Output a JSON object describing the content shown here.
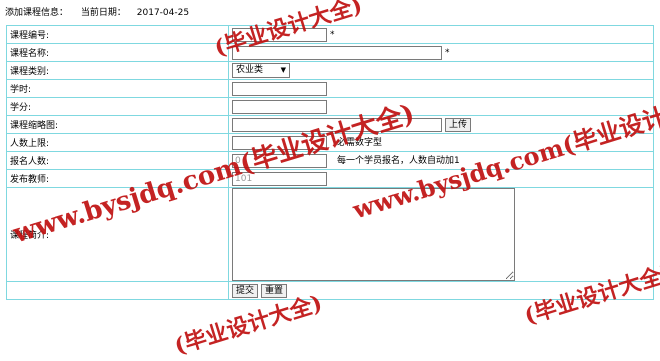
{
  "header": {
    "title": "添加课程信息：",
    "date_label": "当前日期：",
    "date_value": "2017-04-25"
  },
  "form": {
    "course_no": {
      "label": "课程编号:",
      "value": "",
      "required_mark": "*"
    },
    "course_name": {
      "label": "课程名称:",
      "value": "",
      "required_mark": "*"
    },
    "course_category": {
      "label": "课程类别:",
      "selected": "农业类"
    },
    "hours": {
      "label": "学时:",
      "value": ""
    },
    "credits": {
      "label": "学分:",
      "value": ""
    },
    "thumbnail": {
      "label": "课程缩略图:",
      "value": "",
      "upload_label": "上传"
    },
    "max_students": {
      "label": "人数上限:",
      "value": "",
      "hint": "必需数字型"
    },
    "enrolled": {
      "label": "报名人数:",
      "placeholder": "0",
      "hint": "每一个学员报名，人数自动加1"
    },
    "teacher": {
      "label": "发布教师:",
      "placeholder": "101"
    },
    "intro": {
      "label": "课程简介:",
      "value": ""
    },
    "actions": {
      "submit_label": "提交",
      "reset_label": "重置"
    }
  },
  "watermark": {
    "text": "www.bysjdq.com(毕业设计大全)",
    "text_short": "(毕业设计大全)",
    "color": "#c01111"
  }
}
